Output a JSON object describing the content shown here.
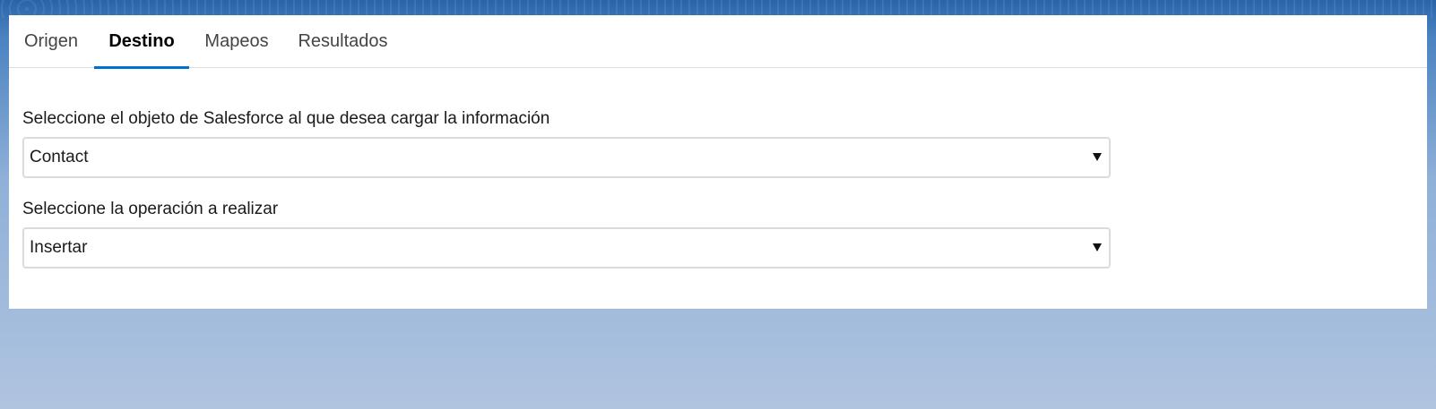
{
  "tabs": [
    {
      "label": "Origen",
      "active": false
    },
    {
      "label": "Destino",
      "active": true
    },
    {
      "label": "Mapeos",
      "active": false
    },
    {
      "label": "Resultados",
      "active": false
    }
  ],
  "form": {
    "object_label": "Seleccione el objeto de Salesforce al que desea cargar la información",
    "object_value": "Contact",
    "operation_label": "Seleccione la operación a realizar",
    "operation_value": "Insertar"
  },
  "colors": {
    "active_tab_underline": "#0070d2",
    "background_top": "#2a64a8",
    "background_bottom": "#b0c4e0"
  }
}
